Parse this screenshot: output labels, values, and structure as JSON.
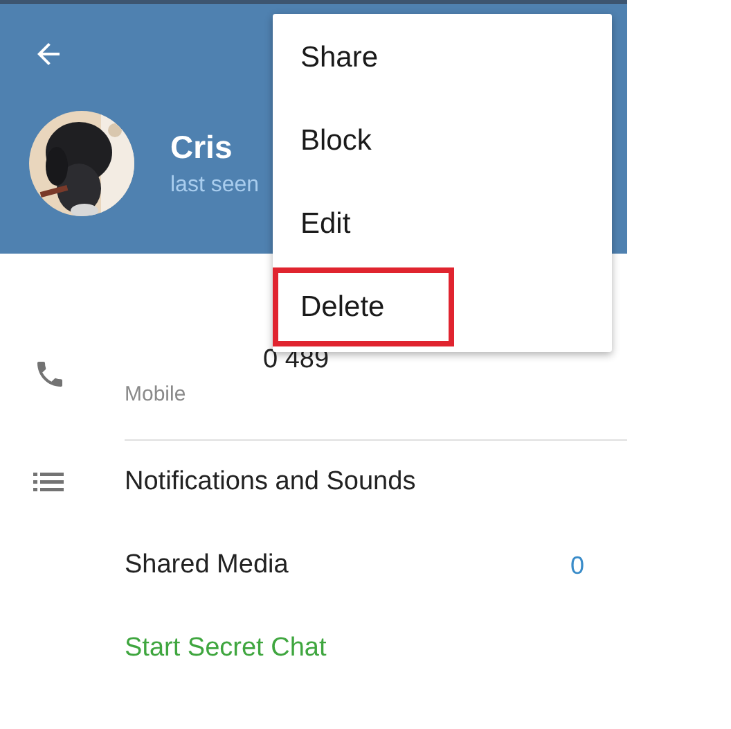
{
  "profile": {
    "name": "Cris",
    "status": "last seen"
  },
  "menu": [
    {
      "label": "Share",
      "highlighted": false
    },
    {
      "label": "Block",
      "highlighted": false
    },
    {
      "label": "Edit",
      "highlighted": false
    },
    {
      "label": "Delete",
      "highlighted": true
    }
  ],
  "phone": {
    "number": "0 489",
    "type": "Mobile"
  },
  "rows": [
    {
      "kind": "icon",
      "label": "Notifications and Sounds"
    },
    {
      "kind": "count",
      "label": "Shared Media",
      "value": "0"
    },
    {
      "kind": "action",
      "label": "Start Secret Chat"
    }
  ]
}
